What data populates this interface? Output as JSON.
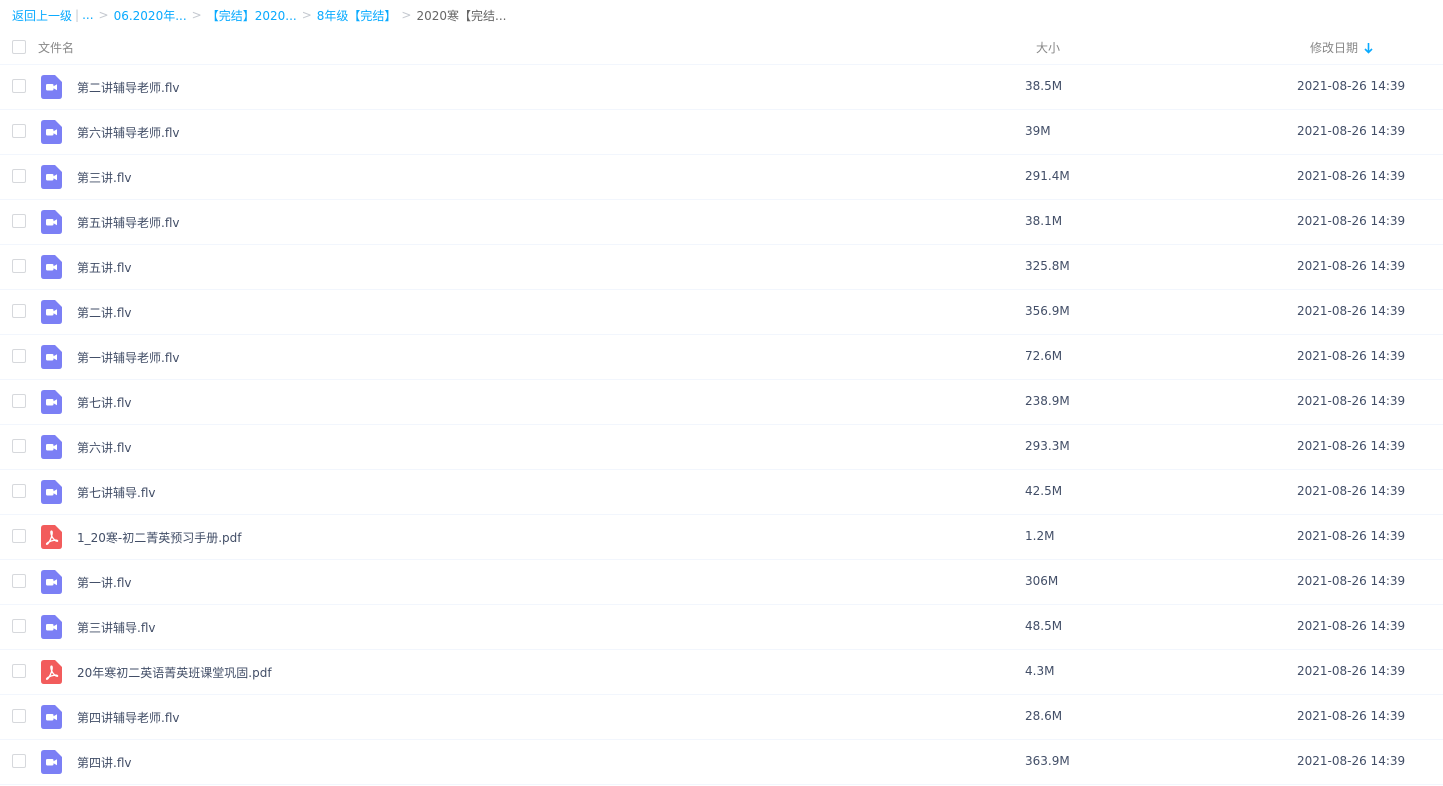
{
  "breadcrumb": {
    "back": "返回上一级",
    "ellipsis": "...",
    "items": [
      "06.2020年...",
      "【完结】2020...",
      "8年级【完结】"
    ],
    "current": "2020寒【完结..."
  },
  "header": {
    "name": "文件名",
    "size": "大小",
    "date": "修改日期"
  },
  "colors": {
    "video_icon": "#7b7ff5",
    "pdf_icon": "#f25c5c",
    "link": "#09aaff"
  },
  "files": [
    {
      "name": "第二讲辅导老师.flv",
      "size": "38.5M",
      "date": "2021-08-26 14:39",
      "icon": "video-icon"
    },
    {
      "name": "第六讲辅导老师.flv",
      "size": "39M",
      "date": "2021-08-26 14:39",
      "icon": "video-icon"
    },
    {
      "name": "第三讲.flv",
      "size": "291.4M",
      "date": "2021-08-26 14:39",
      "icon": "video-icon"
    },
    {
      "name": "第五讲辅导老师.flv",
      "size": "38.1M",
      "date": "2021-08-26 14:39",
      "icon": "video-icon"
    },
    {
      "name": "第五讲.flv",
      "size": "325.8M",
      "date": "2021-08-26 14:39",
      "icon": "video-icon"
    },
    {
      "name": "第二讲.flv",
      "size": "356.9M",
      "date": "2021-08-26 14:39",
      "icon": "video-icon"
    },
    {
      "name": "第一讲辅导老师.flv",
      "size": "72.6M",
      "date": "2021-08-26 14:39",
      "icon": "video-icon"
    },
    {
      "name": "第七讲.flv",
      "size": "238.9M",
      "date": "2021-08-26 14:39",
      "icon": "video-icon"
    },
    {
      "name": "第六讲.flv",
      "size": "293.3M",
      "date": "2021-08-26 14:39",
      "icon": "video-icon"
    },
    {
      "name": "第七讲辅导.flv",
      "size": "42.5M",
      "date": "2021-08-26 14:39",
      "icon": "video-icon"
    },
    {
      "name": "1_20寒-初二菁英预习手册.pdf",
      "size": "1.2M",
      "date": "2021-08-26 14:39",
      "icon": "pdf-icon"
    },
    {
      "name": "第一讲.flv",
      "size": "306M",
      "date": "2021-08-26 14:39",
      "icon": "video-icon"
    },
    {
      "name": "第三讲辅导.flv",
      "size": "48.5M",
      "date": "2021-08-26 14:39",
      "icon": "video-icon"
    },
    {
      "name": "20年寒初二英语菁英班课堂巩固.pdf",
      "size": "4.3M",
      "date": "2021-08-26 14:39",
      "icon": "pdf-icon"
    },
    {
      "name": "第四讲辅导老师.flv",
      "size": "28.6M",
      "date": "2021-08-26 14:39",
      "icon": "video-icon"
    },
    {
      "name": "第四讲.flv",
      "size": "363.9M",
      "date": "2021-08-26 14:39",
      "icon": "video-icon"
    }
  ]
}
